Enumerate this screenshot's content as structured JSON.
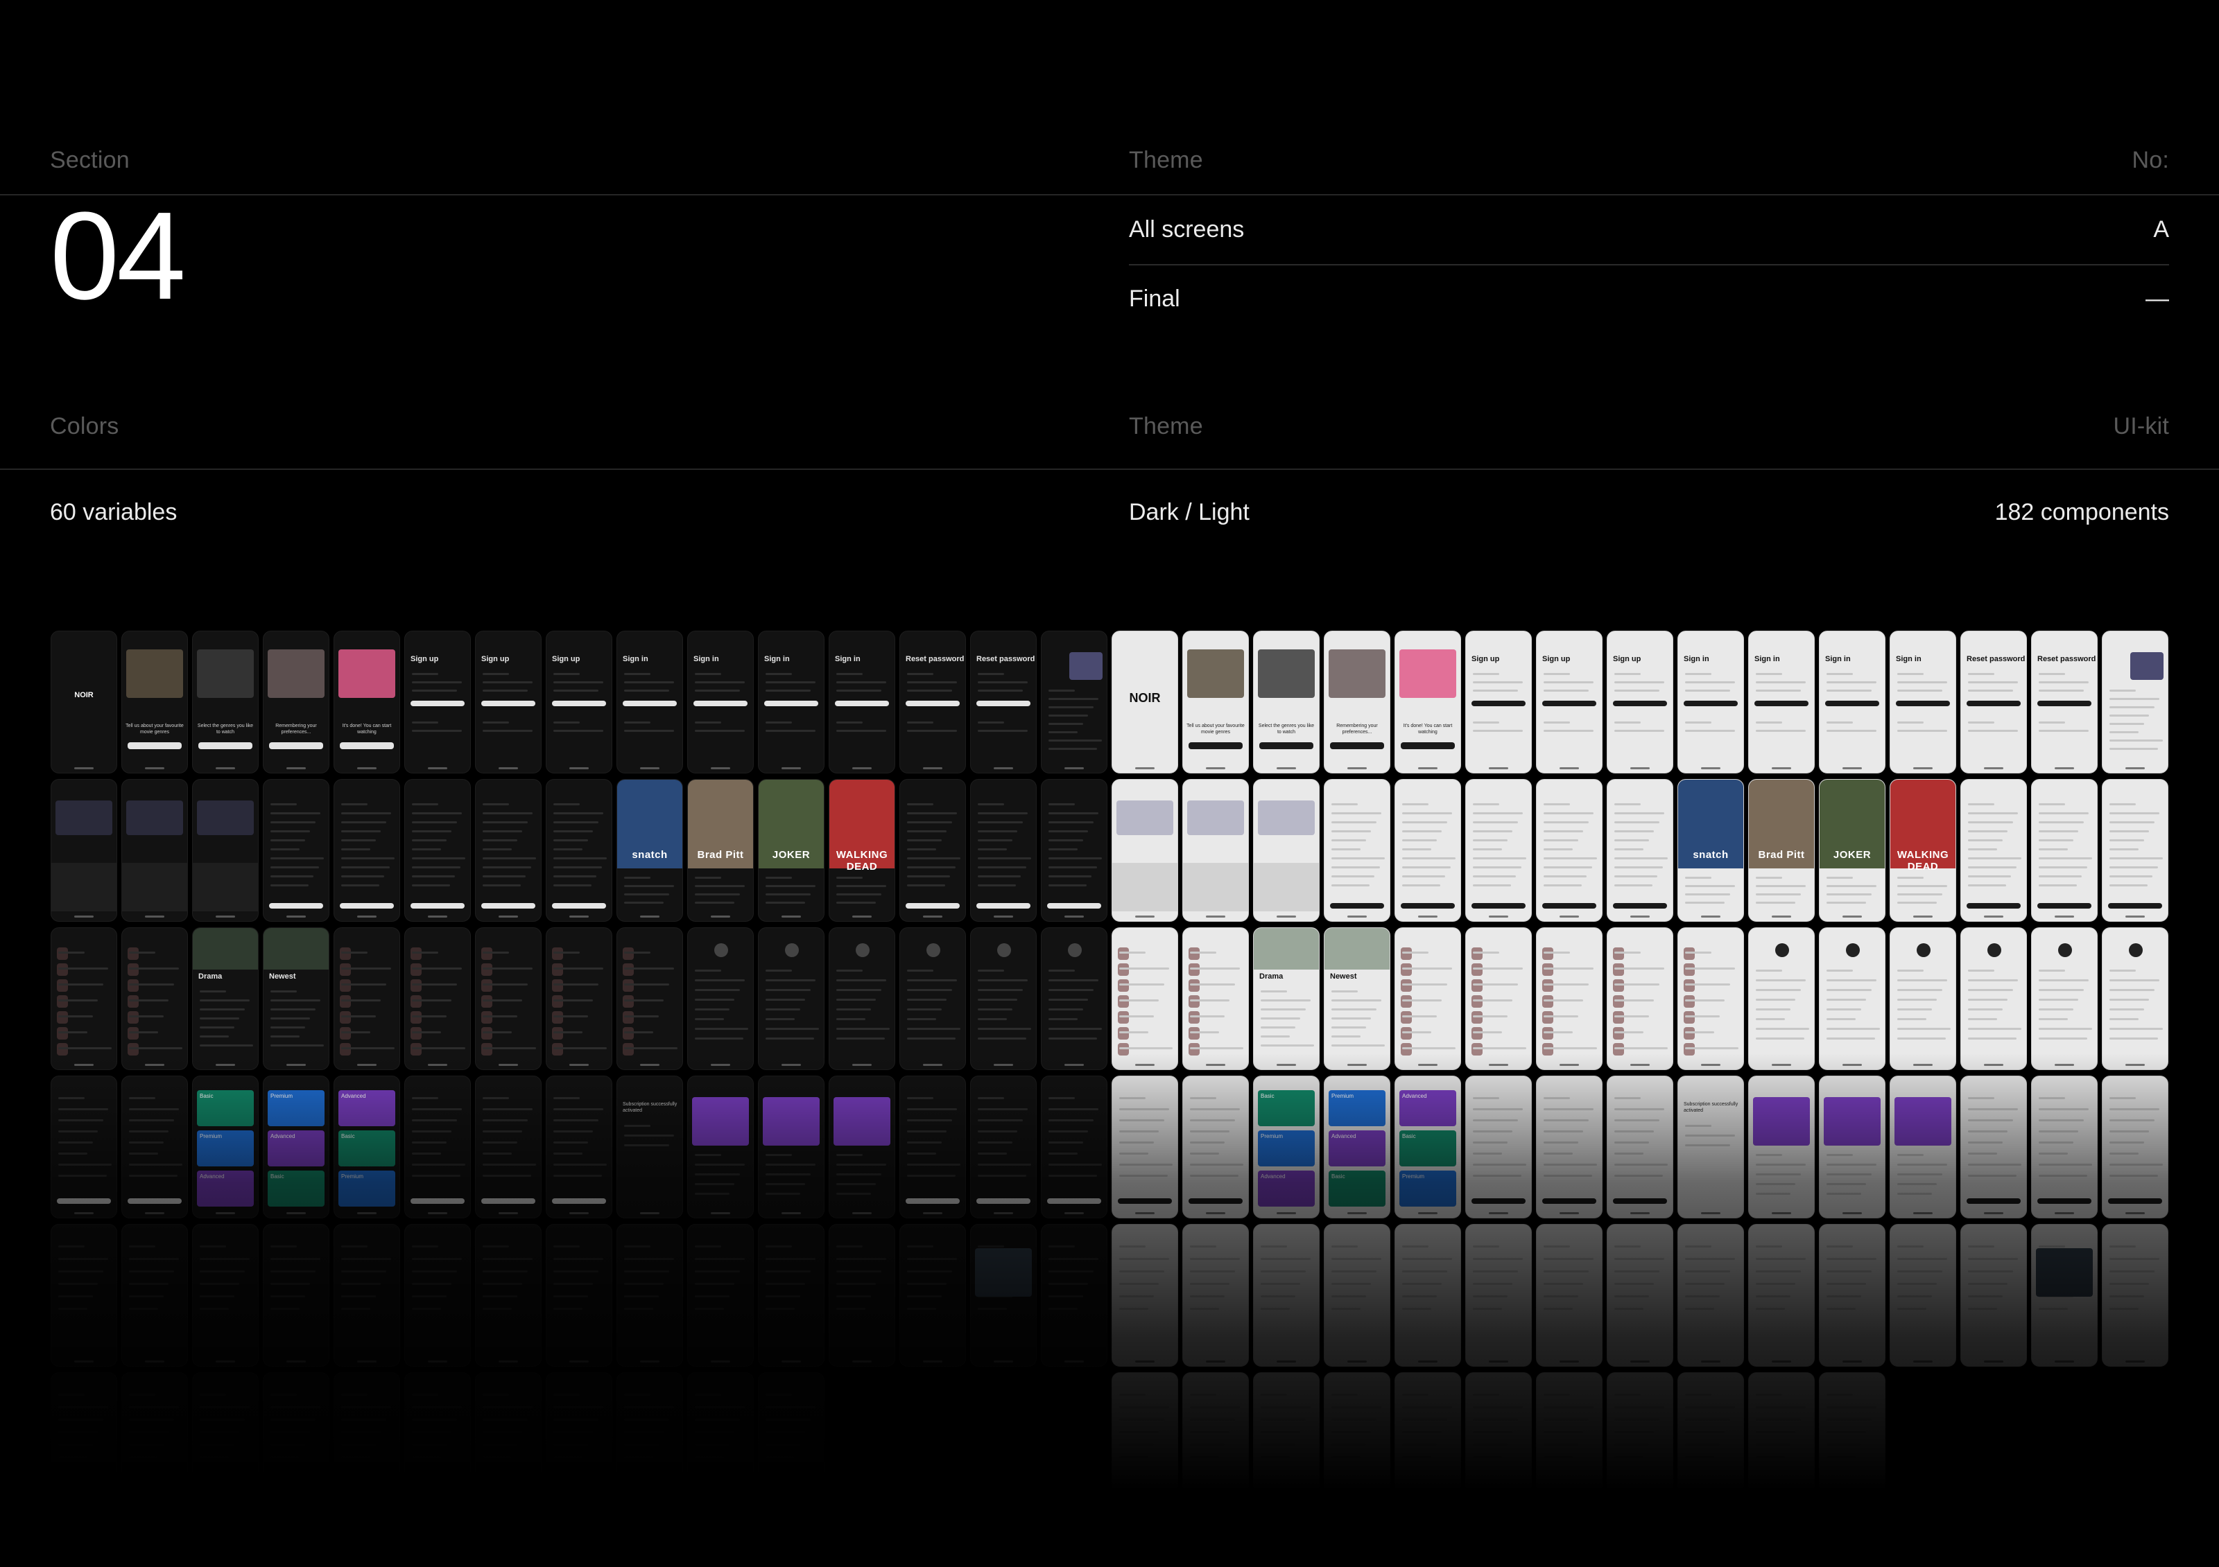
{
  "header": {
    "section_label": "Section",
    "theme_label": "Theme",
    "no_label": "No:",
    "section_number": "04",
    "rows": [
      {
        "name": "All screens",
        "value": "A"
      },
      {
        "name": "Final",
        "value": "—"
      }
    ]
  },
  "meta": {
    "colors_label": "Colors",
    "theme_label": "Theme",
    "uikit_label": "UI-kit",
    "colors_value": "60 variables",
    "theme_value": "Dark / Light",
    "uikit_value": "182 components"
  },
  "screens": {
    "brand": "NOIR",
    "row1_titles": [
      "",
      "",
      "",
      "",
      "",
      "Sign up",
      "Sign up",
      "Sign up",
      "Sign in",
      "Sign in",
      "Sign in",
      "Sign in",
      "Reset password",
      "Reset password",
      ""
    ],
    "onboarding_captions": [
      "Tell us about your favourite movie genres",
      "Select the genres you like to watch",
      "Remembering your preferences...",
      "It's done! You can start watching"
    ],
    "posters": [
      "snatch",
      "Brad Pitt",
      "JOKER",
      "WALKING DEAD"
    ],
    "genre_labels": [
      "Drama",
      "Newest"
    ],
    "plan_labels": [
      "Premium",
      "Advanced",
      "Basic"
    ],
    "subscription_text": "Subscription successfully activated"
  },
  "colors": {
    "background": "#000000",
    "header_text": "#5a5a5a",
    "value_text": "#ececec",
    "rule": "#262626",
    "premium": "#1f6fd6",
    "advanced": "#7b3fc4",
    "basic": "#128a6a",
    "pink_art": "#e05a8a"
  }
}
